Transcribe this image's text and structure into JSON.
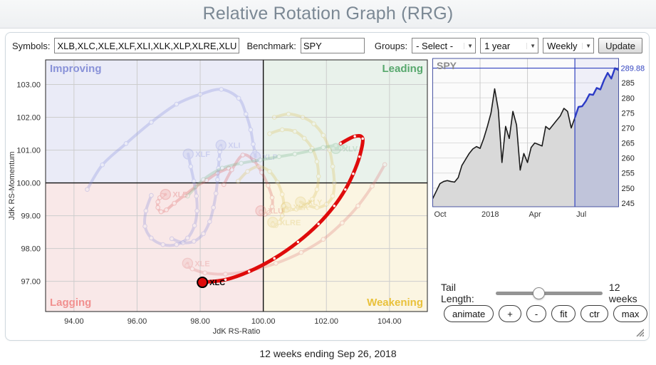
{
  "header": {
    "title": "Relative Rotation Graph (RRG)"
  },
  "toolbar": {
    "symbols_label": "Symbols:",
    "symbols_value": "XLB,XLC,XLE,XLF,XLI,XLK,XLP,XLRE,XLU,XLV,XLY",
    "benchmark_label": "Benchmark:",
    "benchmark_value": "SPY",
    "groups_label": "Groups:",
    "groups_value": "- Select -",
    "period_value": "1 year",
    "frequency_value": "Weekly",
    "update_label": "Update",
    "dropdown_arrow": "▼"
  },
  "controls": {
    "tail_label": "Tail Length:",
    "tail_value": "12 weeks",
    "slider_fraction": 0.4,
    "buttons": [
      "animate",
      "+",
      "-",
      "fit",
      "ctr",
      "max"
    ]
  },
  "footer": {
    "caption": "12 weeks ending Sep 26, 2018"
  },
  "chart_data": [
    {
      "type": "scatter",
      "name": "rrg",
      "xlabel": "JdK RS-Ratio",
      "ylabel": "JdK RS-Momentum",
      "xlim": [
        93.1,
        105.2
      ],
      "ylim": [
        96.08,
        103.75
      ],
      "xticks": [
        94,
        96,
        98,
        100,
        102,
        104
      ],
      "yticks": [
        97,
        98,
        99,
        100,
        101,
        102,
        103
      ],
      "center": [
        100,
        100
      ],
      "grid_color": "#cdcdcd",
      "quadrants": [
        {
          "key": "improving",
          "label": "Improving",
          "color": "#8992d8",
          "bg": "#eaebf7",
          "corner": "tl"
        },
        {
          "key": "leading",
          "label": "Leading",
          "color": "#57a86d",
          "bg": "#e9f2eb",
          "corner": "tr"
        },
        {
          "key": "lagging",
          "label": "Lagging",
          "color": "#f1908f",
          "bg": "#f9e8e8",
          "corner": "bl"
        },
        {
          "key": "weakening",
          "label": "Weakening",
          "color": "#e9c13a",
          "bg": "#fbf5e2",
          "corner": "br"
        }
      ],
      "series": [
        {
          "name": "XLB",
          "color": "#dd5f5f",
          "highlight": false,
          "trail": [
            [
              98.9,
              100.45
            ],
            [
              98.55,
              100.3
            ],
            [
              98.2,
              100.08
            ],
            [
              97.85,
              99.88
            ],
            [
              97.5,
              99.62
            ],
            [
              97.18,
              99.38
            ],
            [
              96.93,
              99.18
            ],
            [
              96.76,
              99.12
            ],
            [
              96.66,
              99.25
            ],
            [
              96.66,
              99.42
            ],
            [
              96.72,
              99.55
            ],
            [
              96.8,
              99.62
            ],
            [
              96.9,
              99.65
            ]
          ]
        },
        {
          "name": "XLE",
          "color": "#e07f7f",
          "highlight": false,
          "trail": [
            [
              103.85,
              100.56
            ],
            [
              103.45,
              99.9
            ],
            [
              103.0,
              99.3
            ],
            [
              102.5,
              98.78
            ],
            [
              101.9,
              98.28
            ],
            [
              101.2,
              97.88
            ],
            [
              100.4,
              97.55
            ],
            [
              99.6,
              97.33
            ],
            [
              98.8,
              97.22
            ],
            [
              98.15,
              97.26
            ],
            [
              97.75,
              97.38
            ],
            [
              97.58,
              97.48
            ],
            [
              97.6,
              97.55
            ]
          ]
        },
        {
          "name": "XLF",
          "color": "#8a92de",
          "highlight": false,
          "trail": [
            [
              96.45,
              99.62
            ],
            [
              96.28,
              99.15
            ],
            [
              96.25,
              98.68
            ],
            [
              96.45,
              98.32
            ],
            [
              96.82,
              98.12
            ],
            [
              97.25,
              98.12
            ],
            [
              97.6,
              98.32
            ],
            [
              97.82,
              98.7
            ],
            [
              97.9,
              99.15
            ],
            [
              97.88,
              99.6
            ],
            [
              97.8,
              100.05
            ],
            [
              97.7,
              100.5
            ],
            [
              97.62,
              100.88
            ]
          ]
        },
        {
          "name": "XLI",
          "color": "#8a92de",
          "highlight": false,
          "trail": [
            [
              97.1,
              98.3
            ],
            [
              97.45,
              98.18
            ],
            [
              97.8,
              98.22
            ],
            [
              98.1,
              98.45
            ],
            [
              98.3,
              98.82
            ],
            [
              98.42,
              99.25
            ],
            [
              98.5,
              99.68
            ],
            [
              98.55,
              100.1
            ],
            [
              98.58,
              100.45
            ],
            [
              98.6,
              100.72
            ],
            [
              98.62,
              100.95
            ],
            [
              98.64,
              101.07
            ],
            [
              98.66,
              101.15
            ]
          ]
        },
        {
          "name": "XLP",
          "color": "#8a92de",
          "highlight": false,
          "trail": [
            [
              94.42,
              99.8
            ],
            [
              94.9,
              100.55
            ],
            [
              95.65,
              101.2
            ],
            [
              96.45,
              101.85
            ],
            [
              97.25,
              102.4
            ],
            [
              98.0,
              102.7
            ],
            [
              98.67,
              102.85
            ],
            [
              99.22,
              102.58
            ],
            [
              99.45,
              102.1
            ],
            [
              99.6,
              101.62
            ],
            [
              99.68,
              101.18
            ],
            [
              99.73,
              100.95
            ],
            [
              99.75,
              100.8
            ]
          ]
        },
        {
          "name": "XLU",
          "color": "#dd6666",
          "highlight": false,
          "trail": [
            [
              98.75,
              99.95
            ],
            [
              99.0,
              100.4
            ],
            [
              99.35,
              100.85
            ],
            [
              99.7,
              100.68
            ],
            [
              99.95,
              100.32
            ],
            [
              100.15,
              99.92
            ],
            [
              100.28,
              99.55
            ],
            [
              100.28,
              99.28
            ],
            [
              100.18,
              99.1
            ],
            [
              100.05,
              99.04
            ],
            [
              99.96,
              99.07
            ],
            [
              99.93,
              99.11
            ],
            [
              99.92,
              99.15
            ]
          ]
        },
        {
          "name": "XLRE",
          "color": "#dcc260",
          "highlight": false,
          "trail": [
            [
              99.2,
              100.05
            ],
            [
              99.5,
              100.35
            ],
            [
              99.85,
              100.5
            ],
            [
              100.2,
              100.35
            ],
            [
              100.45,
              100.02
            ],
            [
              100.6,
              99.65
            ],
            [
              100.65,
              99.3
            ],
            [
              100.6,
              99.0
            ],
            [
              100.5,
              98.8
            ],
            [
              100.4,
              98.7
            ],
            [
              100.33,
              98.7
            ],
            [
              100.3,
              98.74
            ],
            [
              100.3,
              98.8
            ]
          ]
        },
        {
          "name": "XLK",
          "color": "#dcc260",
          "highlight": false,
          "trail": [
            [
              100.2,
              101.5
            ],
            [
              100.6,
              101.62
            ],
            [
              101.0,
              101.57
            ],
            [
              101.3,
              101.36
            ],
            [
              101.55,
              101.05
            ],
            [
              101.7,
              100.65
            ],
            [
              101.75,
              100.2
            ],
            [
              101.7,
              99.8
            ],
            [
              101.55,
              99.5
            ],
            [
              101.3,
              99.3
            ],
            [
              101.05,
              99.2
            ],
            [
              100.85,
              99.2
            ],
            [
              100.72,
              99.26
            ]
          ]
        },
        {
          "name": "XLY",
          "color": "#dcc260",
          "highlight": false,
          "trail": [
            [
              100.35,
              102.0
            ],
            [
              100.8,
              102.1
            ],
            [
              101.25,
              102.0
            ],
            [
              101.6,
              101.8
            ],
            [
              101.9,
              101.45
            ],
            [
              102.1,
              101.0
            ],
            [
              102.2,
              100.5
            ],
            [
              102.25,
              100.0
            ],
            [
              102.2,
              99.6
            ],
            [
              102.0,
              99.35
            ],
            [
              101.7,
              99.25
            ],
            [
              101.4,
              99.32
            ],
            [
              101.18,
              99.42
            ]
          ]
        },
        {
          "name": "XLV",
          "color": "#7db98d",
          "highlight": false,
          "trail": [
            [
              97.6,
              99.6
            ],
            [
              98.1,
              100.1
            ],
            [
              98.7,
              100.45
            ],
            [
              99.3,
              100.6
            ],
            [
              99.9,
              100.7
            ],
            [
              100.5,
              100.8
            ],
            [
              101.0,
              100.88
            ],
            [
              101.5,
              100.98
            ],
            [
              101.9,
              101.08
            ],
            [
              102.3,
              101.14
            ],
            [
              102.6,
              101.1
            ],
            [
              102.45,
              101.06
            ],
            [
              102.3,
              101.05
            ]
          ]
        },
        {
          "name": "XLC",
          "color": "#df0b0b",
          "highlight": true,
          "trail": [
            [
              102.45,
              101.2
            ],
            [
              102.9,
              101.42
            ],
            [
              103.15,
              101.35
            ],
            [
              103.05,
              100.8
            ],
            [
              102.85,
              100.28
            ],
            [
              102.6,
              99.8
            ],
            [
              102.25,
              99.3
            ],
            [
              101.75,
              98.75
            ],
            [
              101.1,
              98.2
            ],
            [
              100.35,
              97.7
            ],
            [
              99.55,
              97.3
            ],
            [
              98.8,
              97.05
            ],
            [
              98.07,
              96.97
            ]
          ]
        }
      ]
    },
    {
      "type": "area",
      "name": "spy",
      "title": "SPY",
      "last_price_label": "289.88",
      "last_price_value": 289.88,
      "ylim": [
        243.8,
        293.1
      ],
      "yticks": [
        245,
        250,
        255,
        260,
        265,
        270,
        275,
        280,
        285
      ],
      "xtick_labels": [
        "Oct",
        "2018",
        "Apr",
        "Jul"
      ],
      "xtick_indices": [
        0,
        13,
        26,
        39
      ],
      "highlight_start_index": 39,
      "values": [
        246.5,
        249,
        251.5,
        252.2,
        252.5,
        252.2,
        252,
        253.5,
        257.5,
        259.5,
        261.5,
        263,
        263.8,
        263.2,
        266.5,
        270.5,
        275,
        283,
        276,
        258.5,
        270.5,
        266.5,
        275.5,
        271,
        256,
        261.5,
        258.5,
        263.5,
        265,
        264.5,
        264,
        270.5,
        269.5,
        271,
        272.5,
        274,
        276.5,
        275.5,
        270,
        273.4,
        277,
        277.2,
        278.9,
        281.2,
        281,
        283.3,
        282.8,
        285.9,
        288.3,
        286.4,
        289.88,
        289.2
      ],
      "colors": {
        "line": "#1a1a1a",
        "fill": "#d9d9d9",
        "hl_line": "#2b3ac6",
        "hl_fill": "#c0c4da",
        "marker_line": "#3344c0",
        "border": "#4a55a2",
        "title": "#8c8c8c",
        "grid": "#dcdcdc"
      }
    }
  ]
}
